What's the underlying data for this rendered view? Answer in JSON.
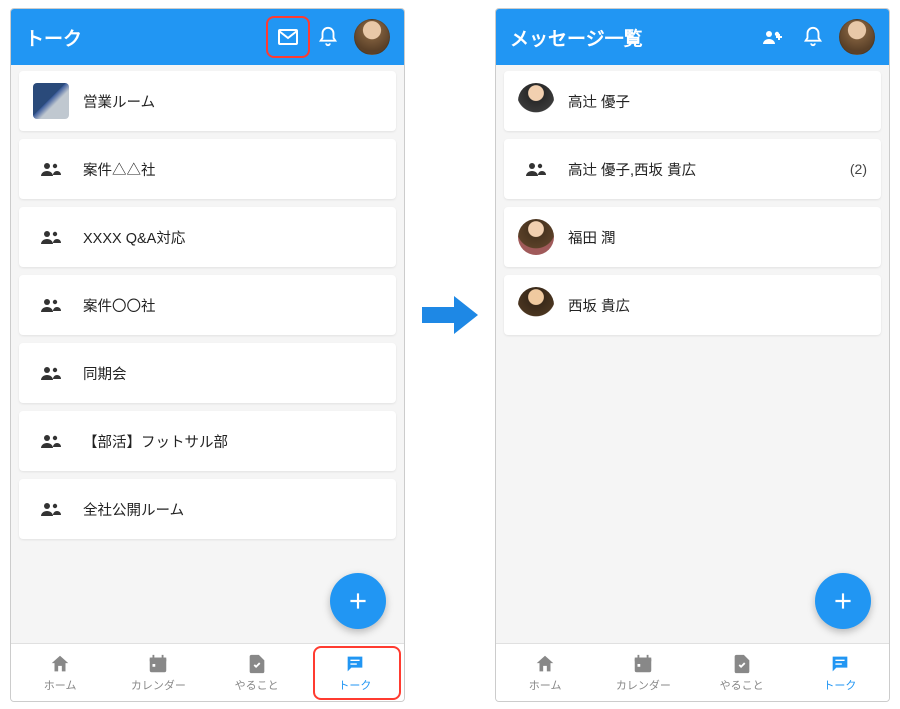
{
  "left": {
    "header_title": "トーク",
    "rooms": [
      {
        "label": "営業ルーム",
        "icon": "photo"
      },
      {
        "label": "案件△△社",
        "icon": "group"
      },
      {
        "label": "XXXX Q&A対応",
        "icon": "group"
      },
      {
        "label": "案件〇〇社",
        "icon": "group"
      },
      {
        "label": "同期会",
        "icon": "group"
      },
      {
        "label": "【部活】フットサル部",
        "icon": "group"
      },
      {
        "label": "全社公開ルーム",
        "icon": "group"
      }
    ]
  },
  "right": {
    "header_title": "メッセージ一覧",
    "messages": [
      {
        "label": "高辻 優子",
        "icon": "person",
        "avatar": "av1"
      },
      {
        "label": "高辻 優子,西坂 貴広",
        "icon": "group",
        "count": "(2)"
      },
      {
        "label": "福田 潤",
        "icon": "person",
        "avatar": "av2"
      },
      {
        "label": "西坂 貴広",
        "icon": "person",
        "avatar": "av3"
      }
    ]
  },
  "nav": {
    "home": "ホーム",
    "calendar": "カレンダー",
    "todo": "やること",
    "talk": "トーク"
  }
}
